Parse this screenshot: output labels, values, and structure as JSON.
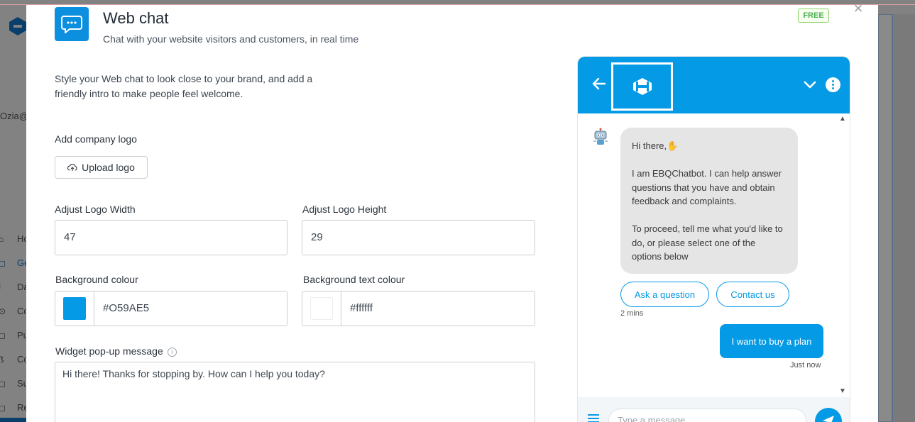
{
  "background": {
    "email_fragment": "Ozia@",
    "nav": [
      {
        "icon": "home-icon",
        "glyph": "⌂",
        "label": "Ho"
      },
      {
        "icon": "grid-icon",
        "glyph": "◻",
        "label": "Ge",
        "active": true
      },
      {
        "icon": "data-icon",
        "glyph": "!",
        "label": "Da"
      },
      {
        "icon": "settings-icon",
        "glyph": "⊙",
        "label": "Co"
      },
      {
        "icon": "publish-icon",
        "glyph": "◻",
        "label": "Pu"
      },
      {
        "icon": "channels-icon",
        "glyph": "ß",
        "label": "Co"
      },
      {
        "icon": "support-icon",
        "glyph": "◻",
        "label": "Su"
      },
      {
        "icon": "reports-icon",
        "glyph": "◻",
        "label": "Re"
      }
    ]
  },
  "header": {
    "title": "Web chat",
    "subtitle": "Chat with your website visitors and customers, in real time",
    "badge": "FREE",
    "close": "×"
  },
  "intro": "Style your Web chat to look close to your brand, and add a friendly intro to make people feel welcome.",
  "logo": {
    "label": "Add company logo",
    "upload_label": "Upload logo"
  },
  "size": {
    "width_label": "Adjust Logo Width",
    "width_value": "47",
    "height_label": "Adjust Logo Height",
    "height_value": "29"
  },
  "colors": {
    "bg_label": "Background colour",
    "bg_value": "#O59AE5",
    "bg_swatch": "#059ae5",
    "text_label": "Background text colour",
    "text_value": "#ffffff",
    "text_swatch": "#ffffff"
  },
  "popup": {
    "label": "Widget pop-up message",
    "value": "Hi there! Thanks for stopping by. How can I help you today?"
  },
  "chat": {
    "accent": "#059ae5",
    "bot_lines": {
      "greeting": "Hi there,✋",
      "p1": "I am EBQChatbot. I can help answer questions that you have and obtain feedback and complaints.",
      "p2": "To proceed, tell me what you'd like to do, or please select one of the options below"
    },
    "options": [
      "Ask a question",
      "Contact us"
    ],
    "bot_time": "2 mins",
    "user_message": "I want to buy a plan",
    "user_time": "Just now",
    "input_placeholder": "Type a message..."
  }
}
